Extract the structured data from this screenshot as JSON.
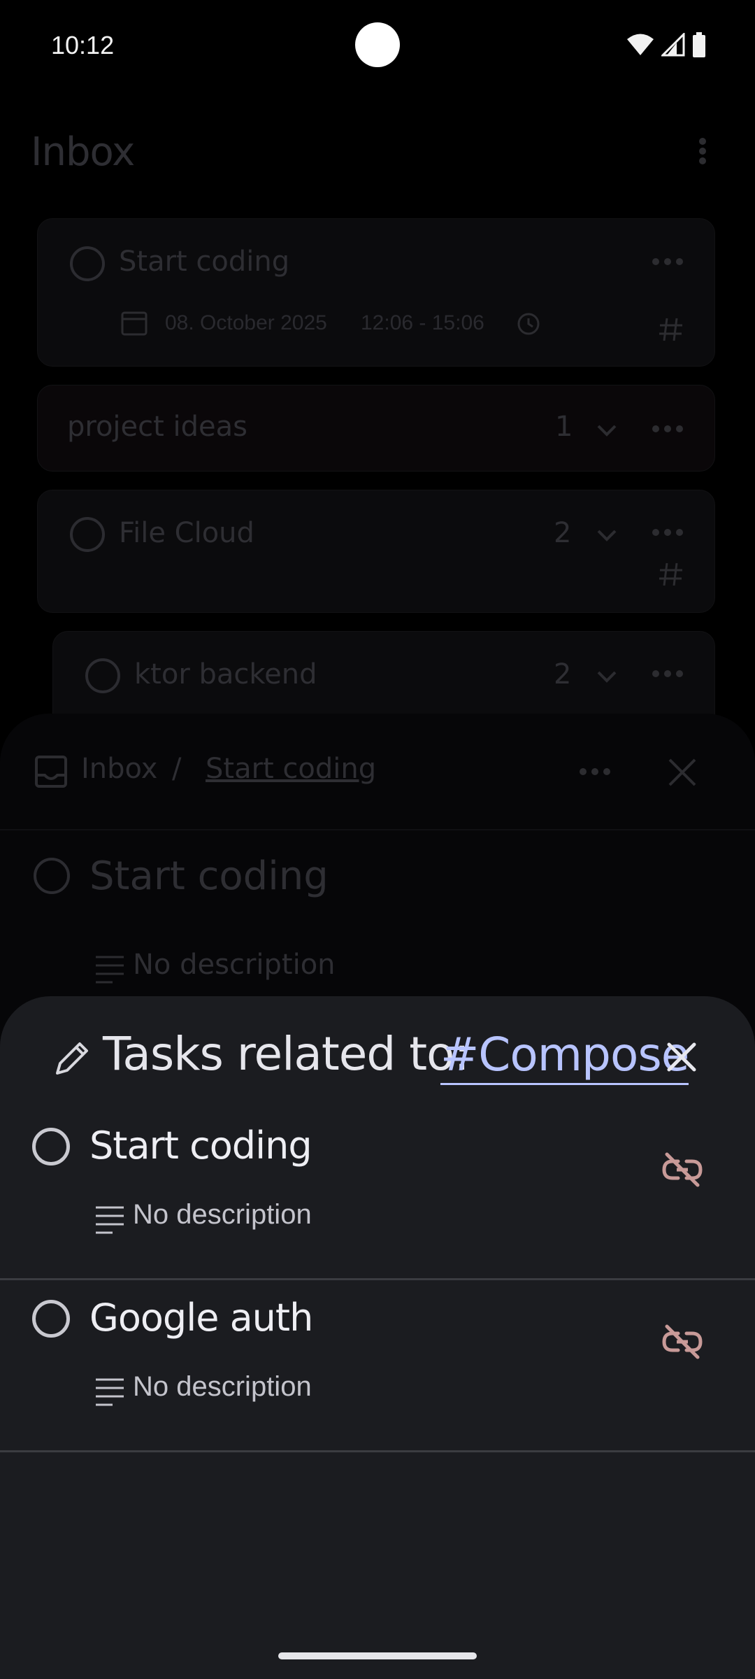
{
  "status_bar": {
    "time": "10:12",
    "icons": [
      "wifi-icon",
      "signal-icon",
      "battery-icon"
    ]
  },
  "background": {
    "title": "Inbox",
    "tasks": [
      {
        "title": "Start coding",
        "date": "08. October 2025",
        "time_range": "12:06 - 15:06"
      },
      {
        "title": "project ideas",
        "count": "1"
      },
      {
        "title": "File Cloud",
        "count": "2"
      },
      {
        "title": "ktor backend",
        "count": "2"
      }
    ]
  },
  "detail": {
    "breadcrumb_root": "Inbox",
    "breadcrumb_separator": "/",
    "breadcrumb_current": "Start coding",
    "task_title": "Start coding",
    "description": "No description"
  },
  "sheet": {
    "title_prefix": "Tasks related to:",
    "tag": "#Compose",
    "tasks": [
      {
        "title": "Start coding",
        "description": "No description"
      },
      {
        "title": "Google auth",
        "description": "No description"
      }
    ]
  },
  "colors": {
    "sheet_background": "#1b1c20",
    "tag_link": "#b8c4ff",
    "unlink_icon": "#c89a98"
  }
}
